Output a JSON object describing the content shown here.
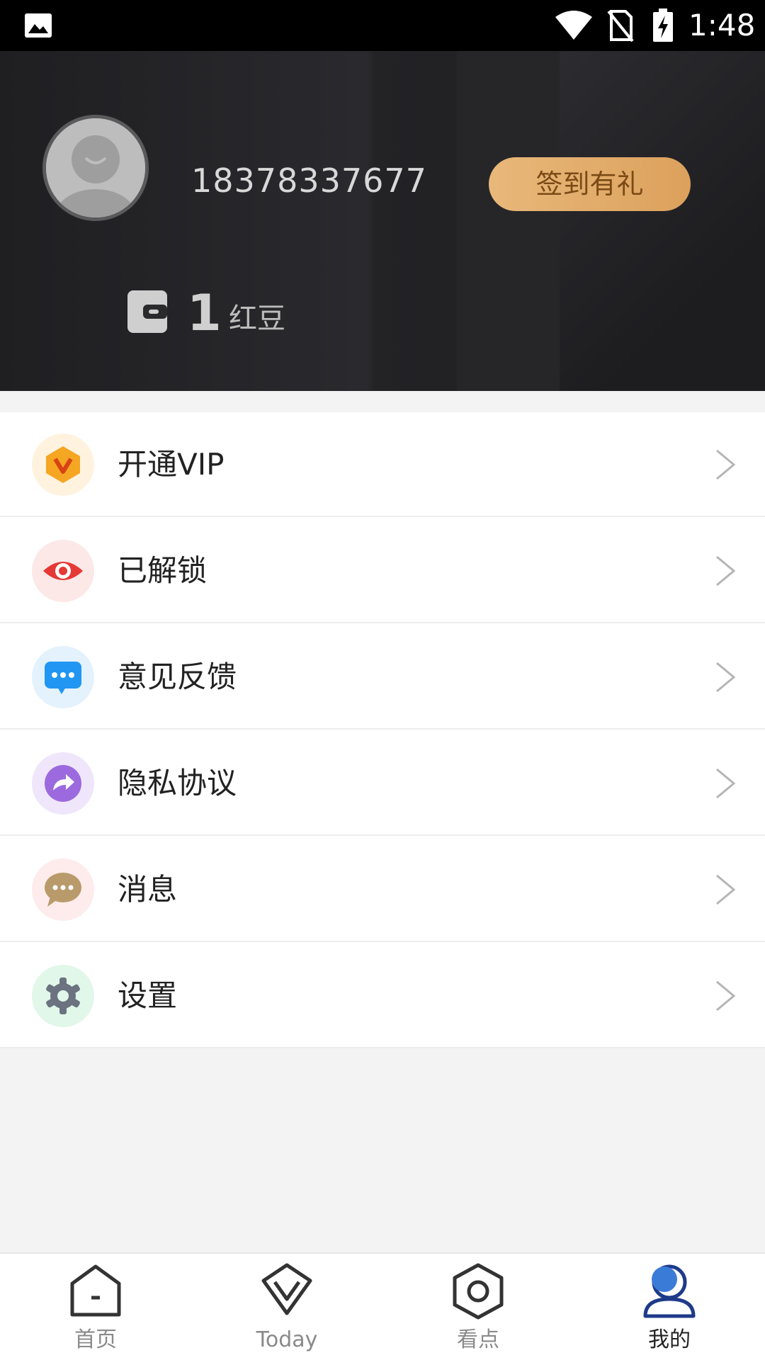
{
  "status_bar": {
    "time": "1:48",
    "icons": [
      "gallery-icon",
      "wifi-icon",
      "no-sim-icon",
      "battery-charging-icon"
    ]
  },
  "profile": {
    "phone": "18378337677",
    "checkin_label": "签到有礼",
    "balance_value": "1",
    "balance_unit": "红豆",
    "avatar_icon": "avatar-placeholder-icon",
    "wallet_icon": "wallet-icon"
  },
  "menu": [
    {
      "label": "开通VIP",
      "icon": "vip-icon",
      "color": "#f5a623"
    },
    {
      "label": "已解锁",
      "icon": "eye-icon",
      "color": "#e53935"
    },
    {
      "label": "意见反馈",
      "icon": "chat-bubble-icon",
      "color": "#2196f3"
    },
    {
      "label": "隐私协议",
      "icon": "share-arrow-icon",
      "color": "#9c6ade"
    },
    {
      "label": "消息",
      "icon": "message-icon",
      "color": "#b99a6b"
    },
    {
      "label": "设置",
      "icon": "gear-icon",
      "color": "#6b7280"
    }
  ],
  "bottom_nav": [
    {
      "label": "首页",
      "icon": "home-icon",
      "active": false
    },
    {
      "label": "Today",
      "icon": "today-icon",
      "active": false
    },
    {
      "label": "看点",
      "icon": "hexagon-icon",
      "active": false
    },
    {
      "label": "我的",
      "icon": "profile-icon",
      "active": true
    }
  ],
  "colors": {
    "accent": "#1e3a8a",
    "checkin_gradient_start": "#e8b87a",
    "checkin_gradient_end": "#dca15c",
    "header_bg": "#232326"
  }
}
